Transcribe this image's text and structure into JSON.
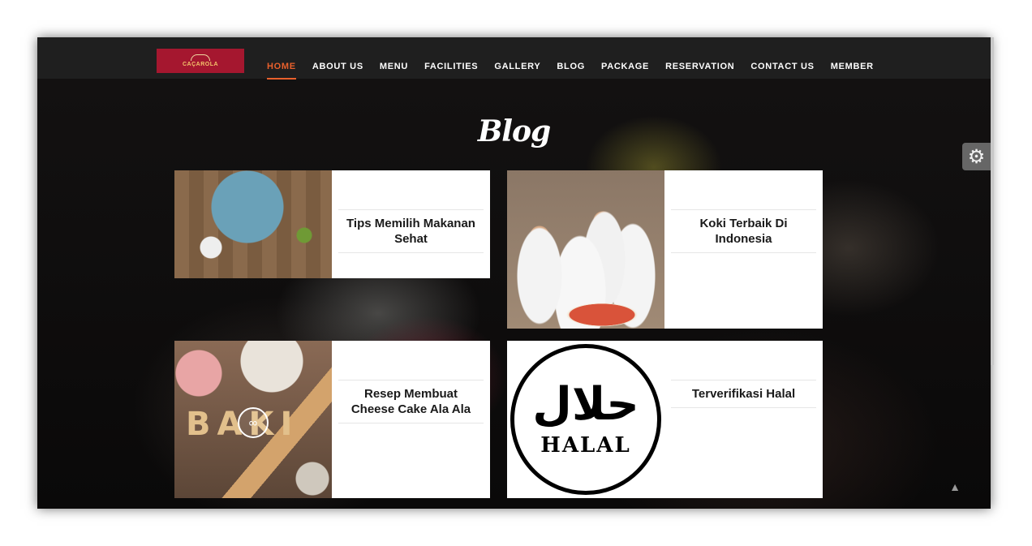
{
  "brand": {
    "logo_text": "CAÇAROLA"
  },
  "nav": {
    "items": [
      {
        "label": "HOME",
        "active": true
      },
      {
        "label": "ABOUT US"
      },
      {
        "label": "MENU"
      },
      {
        "label": "FACILITIES"
      },
      {
        "label": "GALLERY"
      },
      {
        "label": "BLOG"
      },
      {
        "label": "PACKAGE"
      },
      {
        "label": "RESERVATION"
      },
      {
        "label": "CONTACT US"
      },
      {
        "label": "MEMBER"
      }
    ]
  },
  "section": {
    "title": "Blog"
  },
  "posts": [
    {
      "title": "Tips Memilih Makanan Sehat",
      "image": "healthy-food-image"
    },
    {
      "title": "Koki Terbaik Di Indonesia",
      "image": "chefs-image"
    },
    {
      "title": "Resep Membuat Cheese Cake Ala Ala",
      "image": "baking-image",
      "image_text": "BAKI"
    },
    {
      "title": "Terverifikasi Halal",
      "image": "halal-logo-image",
      "image_text_ar": "حلال",
      "image_text_en": "HALAL"
    }
  ],
  "colors": {
    "accent": "#e8602c",
    "navbar": "#1f1f1f",
    "logo_bg": "#a5172f"
  },
  "icons": {
    "settings": "gear-icon",
    "scroll_top": "chevron-up-icon",
    "link": "link-icon"
  }
}
